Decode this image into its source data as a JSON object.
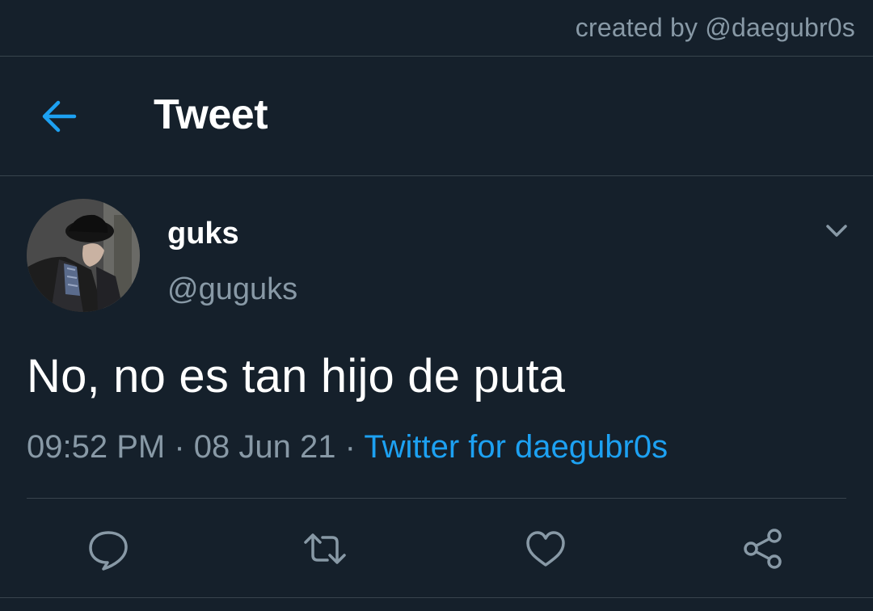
{
  "watermark": "created by @daegubr0s",
  "header": {
    "title": "Tweet",
    "back_icon": "arrow-left-icon"
  },
  "tweet": {
    "author": {
      "display_name": "guks",
      "handle": "@guguks"
    },
    "text": "No, no es tan hijo de puta",
    "time": "09:52 PM",
    "separator": "·",
    "date": "08 Jun 21",
    "source": "Twitter for daegubr0s"
  },
  "actions": [
    {
      "icon": "reply-icon"
    },
    {
      "icon": "retweet-icon"
    },
    {
      "icon": "like-icon"
    },
    {
      "icon": "share-icon"
    }
  ],
  "colors": {
    "background": "#15202b",
    "accent": "#1da1f2",
    "secondary_text": "#8899a6",
    "divider": "#38444d"
  }
}
